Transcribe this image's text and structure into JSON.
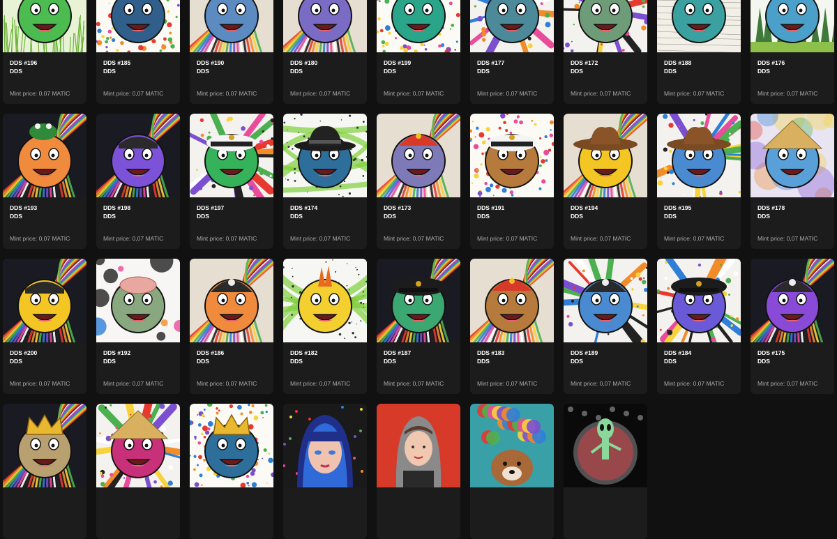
{
  "collection": "DDS",
  "price_label": "Mint price: 0,07 MATIC",
  "cards": [
    {
      "title": "DDS #196",
      "collection": "DDS",
      "price": "Mint price: 0,07 MATIC",
      "art": "emoji",
      "bg": "green-field",
      "face": "#4cbb50",
      "hat": "none"
    },
    {
      "title": "DDS #185",
      "collection": "DDS",
      "price": "Mint price: 0,07 MATIC",
      "art": "emoji",
      "bg": "confetti",
      "face": "#2f5f8a",
      "hat": "none"
    },
    {
      "title": "DDS #190",
      "collection": "DDS",
      "price": "Mint price: 0,07 MATIC",
      "art": "emoji",
      "bg": "swirl",
      "face": "#5b8bc0",
      "hat": "none"
    },
    {
      "title": "DDS #180",
      "collection": "DDS",
      "price": "Mint price: 0,07 MATIC",
      "art": "emoji",
      "bg": "swirl",
      "face": "#7a6bc4",
      "hat": "none"
    },
    {
      "title": "DDS #199",
      "collection": "DDS",
      "price": "Mint price: 0,07 MATIC",
      "art": "emoji",
      "bg": "confetti",
      "face": "#2aa58a",
      "hat": "none"
    },
    {
      "title": "DDS #177",
      "collection": "DDS",
      "price": "Mint price: 0,07 MATIC",
      "art": "emoji",
      "bg": "splash",
      "face": "#4c8a9a",
      "hat": "none"
    },
    {
      "title": "DDS #172",
      "collection": "DDS",
      "price": "Mint price: 0,07 MATIC",
      "art": "emoji",
      "bg": "splash",
      "face": "#6f9c78",
      "hat": "none"
    },
    {
      "title": "DDS #188",
      "collection": "DDS",
      "price": "Mint price: 0,07 MATIC",
      "art": "emoji",
      "bg": "paper",
      "face": "#3aa0a0",
      "hat": "none"
    },
    {
      "title": "DDS #176",
      "collection": "DDS",
      "price": "Mint price: 0,07 MATIC",
      "art": "emoji",
      "bg": "forest",
      "face": "#4aa0c8",
      "hat": "none"
    },
    {
      "title": "DDS #193",
      "collection": "DDS",
      "price": "Mint price: 0,07 MATIC",
      "art": "emoji",
      "bg": "dark-swirl",
      "face": "#f08a3c",
      "hat": "frog"
    },
    {
      "title": "DDS #198",
      "collection": "DDS",
      "price": "Mint price: 0,07 MATIC",
      "art": "emoji",
      "bg": "dark-swirl",
      "face": "#7b52d8",
      "hat": "bandana"
    },
    {
      "title": "DDS #197",
      "collection": "DDS",
      "price": "Mint price: 0,07 MATIC",
      "art": "emoji",
      "bg": "splash",
      "face": "#35b25a",
      "hat": "captain"
    },
    {
      "title": "DDS #174",
      "collection": "DDS",
      "price": "Mint price: 0,07 MATIC",
      "art": "emoji",
      "bg": "green-paint",
      "face": "#2e6e9a",
      "hat": "fedora"
    },
    {
      "title": "DDS #173",
      "collection": "DDS",
      "price": "Mint price: 0,07 MATIC",
      "art": "emoji",
      "bg": "swirl",
      "face": "#7e7ab8",
      "hat": "red-cap"
    },
    {
      "title": "DDS #191",
      "collection": "DDS",
      "price": "Mint price: 0,07 MATIC",
      "art": "emoji",
      "bg": "confetti",
      "face": "#b57a3c",
      "hat": "captain"
    },
    {
      "title": "DDS #194",
      "collection": "DDS",
      "price": "Mint price: 0,07 MATIC",
      "art": "emoji",
      "bg": "swirl",
      "face": "#f3c623",
      "hat": "cowboy"
    },
    {
      "title": "DDS #195",
      "collection": "DDS",
      "price": "Mint price: 0,07 MATIC",
      "art": "emoji",
      "bg": "splash",
      "face": "#4a8ad0",
      "hat": "cowboy"
    },
    {
      "title": "DDS #178",
      "collection": "DDS",
      "price": "Mint price: 0,07 MATIC",
      "art": "emoji",
      "bg": "watercolor",
      "face": "#5aa0d8",
      "hat": "conical"
    },
    {
      "title": "DDS #200",
      "collection": "DDS",
      "price": "Mint price: 0,07 MATIC",
      "art": "emoji",
      "bg": "dark-swirl",
      "face": "#f3c623",
      "hat": "bandana"
    },
    {
      "title": "DDS #192",
      "collection": "DDS",
      "price": "Mint price: 0,07 MATIC",
      "art": "emoji",
      "bg": "ink",
      "face": "#8aa880",
      "hat": "brain"
    },
    {
      "title": "DDS #186",
      "collection": "DDS",
      "price": "Mint price: 0,07 MATIC",
      "art": "emoji",
      "bg": "swirl",
      "face": "#f08a3c",
      "hat": "pirate"
    },
    {
      "title": "DDS #182",
      "collection": "DDS",
      "price": "Mint price: 0,07 MATIC",
      "art": "emoji",
      "bg": "green-paint",
      "face": "#f3d030",
      "hat": "mohawk"
    },
    {
      "title": "DDS #187",
      "collection": "DDS",
      "price": "Mint price: 0,07 MATIC",
      "art": "emoji",
      "bg": "dark-swirl",
      "face": "#3aa870",
      "hat": "officer"
    },
    {
      "title": "DDS #183",
      "collection": "DDS",
      "price": "Mint price: 0,07 MATIC",
      "art": "emoji",
      "bg": "swirl",
      "face": "#b57a3c",
      "hat": "red-cap"
    },
    {
      "title": "DDS #189",
      "collection": "DDS",
      "price": "Mint price: 0,07 MATIC",
      "art": "emoji",
      "bg": "splash",
      "face": "#4a8ad0",
      "hat": "pirate"
    },
    {
      "title": "DDS #184",
      "collection": "DDS",
      "price": "Mint price: 0,07 MATIC",
      "art": "emoji",
      "bg": "splash",
      "face": "#6a5ad8",
      "hat": "officer"
    },
    {
      "title": "DDS #175",
      "collection": "DDS",
      "price": "Mint price: 0,07 MATIC",
      "art": "emoji",
      "bg": "dark-swirl",
      "face": "#8a4ad8",
      "hat": "pirate"
    },
    {
      "title": "",
      "collection": "",
      "price": "",
      "art": "emoji",
      "bg": "dark-swirl",
      "face": "#b8a070",
      "hat": "crown"
    },
    {
      "title": "",
      "collection": "",
      "price": "",
      "art": "emoji",
      "bg": "splash",
      "face": "#c8307a",
      "hat": "conical"
    },
    {
      "title": "",
      "collection": "",
      "price": "",
      "art": "emoji",
      "bg": "confetti",
      "face": "#2e6e9a",
      "hat": "crown"
    },
    {
      "title": "",
      "collection": "",
      "price": "",
      "art": "portrait-pop",
      "bg": "",
      "face": "#e8b8a8",
      "hat": "none"
    },
    {
      "title": "",
      "collection": "",
      "price": "",
      "art": "portrait-hood",
      "bg": "",
      "face": "#e8b8a8",
      "hat": "none"
    },
    {
      "title": "",
      "collection": "",
      "price": "",
      "art": "dog",
      "bg": "",
      "face": "#a86838",
      "hat": "none"
    },
    {
      "title": "",
      "collection": "",
      "price": "",
      "art": "alien",
      "bg": "",
      "face": "#7ac88a",
      "hat": "none"
    }
  ]
}
